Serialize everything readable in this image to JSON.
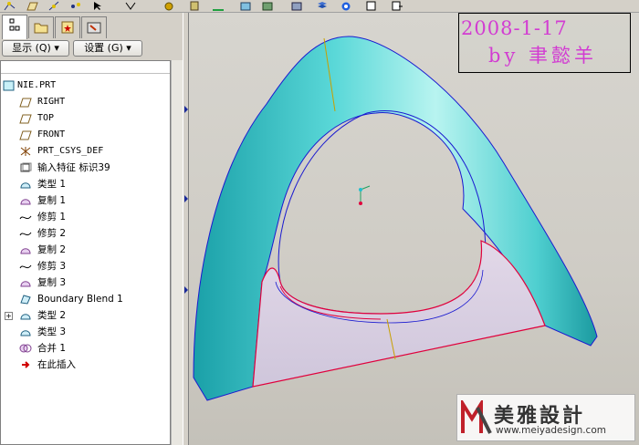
{
  "toolbar": {
    "icons": [
      "sketch-icon",
      "datum-plane-icon",
      "datum-axis-icon",
      "datum-point-icon",
      "select-icon",
      "view-icon",
      "layer-icon",
      "orient-icon",
      "zoom-icon",
      "repaint-icon",
      "saved-view-icon",
      "refit-icon"
    ]
  },
  "left_panel": {
    "tabs": [
      "model-tree-tab",
      "folder-browser-tab",
      "favorites-tab",
      "connections-tab"
    ],
    "menus": {
      "show_label": "显示 (Q) ▾",
      "settings_label": "设置 (G) ▾"
    },
    "tree": {
      "root": "NIE.PRT",
      "items": [
        {
          "label": "RIGHT",
          "icon": "datum-plane-icon"
        },
        {
          "label": "TOP",
          "icon": "datum-plane-icon"
        },
        {
          "label": "FRONT",
          "icon": "datum-plane-icon"
        },
        {
          "label": "PRT_CSYS_DEF",
          "icon": "csys-icon"
        },
        {
          "label": "输入特征 标识39",
          "icon": "import-feature-icon"
        },
        {
          "label": "类型 1",
          "icon": "quilt-icon"
        },
        {
          "label": "复制 1",
          "icon": "copy-surface-icon"
        },
        {
          "label": "修剪 1",
          "icon": "trim-icon"
        },
        {
          "label": "修剪 2",
          "icon": "trim-icon"
        },
        {
          "label": "复制 2",
          "icon": "copy-surface-icon"
        },
        {
          "label": "修剪 3",
          "icon": "trim-icon"
        },
        {
          "label": "复制 3",
          "icon": "copy-surface-icon"
        },
        {
          "label": "Boundary Blend 1",
          "icon": "boundary-blend-icon"
        },
        {
          "label": "类型 2",
          "icon": "quilt-icon",
          "expandable": true
        },
        {
          "label": "类型 3",
          "icon": "quilt-icon"
        },
        {
          "label": "合并 1",
          "icon": "merge-icon"
        },
        {
          "label": "在此插入",
          "icon": "insert-here-arrow-icon"
        }
      ]
    }
  },
  "viewport": {
    "overlay_date": "2008-1-17",
    "overlay_by": "by 聿懿羊",
    "watermark_brand": "美雅設計",
    "watermark_url": "www.meiyadesign.com"
  },
  "colors": {
    "surface_cyan": "#4fd0d0",
    "surface_pink": "#e6d6e6",
    "edge_red": "#e0003c",
    "edge_blue": "#1a1ad0",
    "overlay_text": "#d23cd2"
  }
}
